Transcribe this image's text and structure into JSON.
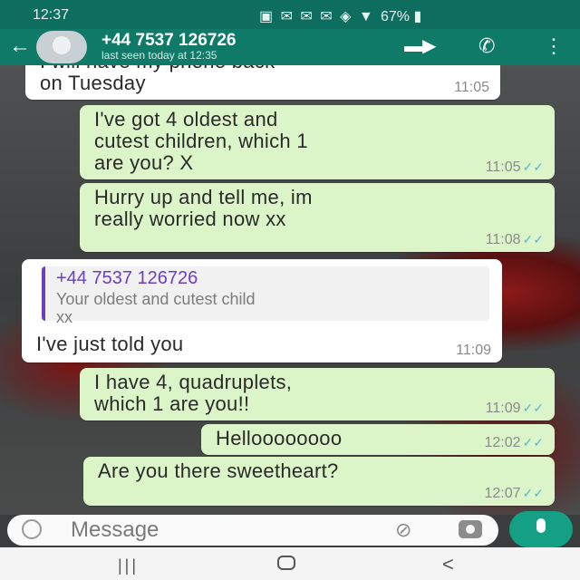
{
  "status_bar": {
    "time": "12:37",
    "icons": "▣ ✉ ✉ ✉ ◈ ▼",
    "battery": "67% ▮"
  },
  "header": {
    "back_icon": "back-arrow-icon",
    "contact_name": "+44 7537 126726",
    "last_seen": "last seen today at 12:35"
  },
  "messages": [
    {
      "type": "in",
      "text": "I will have my phone back\non Tuesday",
      "time": "11:05"
    },
    {
      "type": "out",
      "text": "I've got 4 oldest and\ncutest children, which 1\nare you? X",
      "time": "11:05"
    },
    {
      "type": "out",
      "text": "Hurry up and tell me, im\nreally worried now xx",
      "time": "11:08"
    },
    {
      "type": "in",
      "quote_name": "+44 7537 126726",
      "quote_text": "Your oldest and cutest child\nxx",
      "text": "I've just told you",
      "time": "11:09"
    },
    {
      "type": "out",
      "text": "I have 4, quadruplets,\nwhich 1 are you!!",
      "time": "11:09"
    },
    {
      "type": "out",
      "text": "Helloooooooo",
      "time": "12:02"
    },
    {
      "type": "out",
      "text": "Are you there sweetheart?",
      "time": "12:07"
    }
  ],
  "input": {
    "placeholder": "Message"
  },
  "icons": {
    "tick": "✓✓",
    "back": "←",
    "video": "▬▶",
    "call": "✆",
    "menu": "⋮",
    "attach": "⊘",
    "nav_recent": "|||",
    "nav_back": "<"
  },
  "colors": {
    "header": "#0f7a68",
    "outgoing_bubble": "#dcf5c8",
    "incoming_bubble": "#ffffff",
    "accent": "#14a085",
    "quote_bar": "#6d3fc0"
  }
}
